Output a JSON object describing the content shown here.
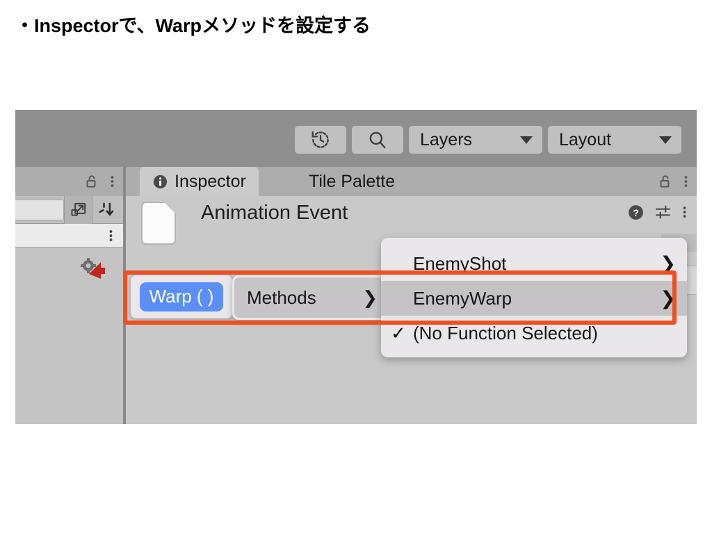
{
  "slide": {
    "title": "・Inspectorで、Warpメソッドを設定する"
  },
  "colors": {
    "accent_orange": "#ef4f23",
    "selection_blue": "#5b8ef7",
    "toolbar_gray": "#8f8f8f",
    "panel_gray": "#c9c9c9",
    "menu_gray": "#e9e7e9"
  },
  "toolbar": {
    "history_icon": "history-icon",
    "search_icon": "search-icon",
    "layers_label": "Layers",
    "layout_label": "Layout",
    "caret_icon": "chevron-down-icon"
  },
  "left_panel": {
    "lock_icon": "lock-open-icon",
    "menu_icon": "kebab-menu-icon",
    "expand_icon": "expand-arrow-icon",
    "sort_icon": "sort-descending-icon",
    "asset_icon": "script-asset-icon"
  },
  "inspector": {
    "tabs": [
      {
        "label": "Inspector",
        "icon": "info-icon",
        "active": true
      },
      {
        "label": "Tile Palette",
        "icon": "",
        "active": false
      }
    ],
    "lock_icon": "lock-open-icon",
    "menu_icon": "kebab-menu-icon",
    "event": {
      "title": "Animation Event",
      "doc_icon": "document-icon",
      "help_icon": "help-circle-icon",
      "settings_icon": "settings-sliders-icon",
      "menu_icon": "kebab-menu-icon"
    }
  },
  "popups": {
    "function_pill": {
      "label": "Warp (  )"
    },
    "methods_menu": {
      "label": "Methods",
      "arrow_icon": "chevron-right-icon"
    },
    "functions_menu": {
      "items": [
        {
          "check": "",
          "label": "EnemyShot",
          "arrow": "❯",
          "selected": false
        },
        {
          "check": "",
          "label": "EnemyWarp",
          "arrow": "❯",
          "selected": true
        },
        {
          "check": "✓",
          "label": "(No Function Selected)",
          "arrow": "",
          "selected": false
        }
      ]
    }
  },
  "annotation": {
    "highlight_box": "orange-highlight-box"
  }
}
